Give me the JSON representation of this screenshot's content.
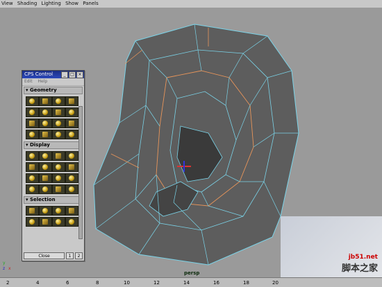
{
  "menu": [
    "View",
    "Shading",
    "Lighting",
    "Show",
    "Panels"
  ],
  "viewport": {
    "camera": "persp",
    "axis_labels": [
      "y",
      "z",
      "x"
    ]
  },
  "cps_control": {
    "title": "CPS Control",
    "menu": [
      "Edit",
      "Help"
    ],
    "sections": [
      {
        "label": "Geometry"
      },
      {
        "label": "Display"
      },
      {
        "label": "Selection"
      }
    ],
    "close_label": "Close",
    "small_buttons": [
      "1",
      "2"
    ]
  },
  "timeline": {
    "labels": [
      "2",
      "4",
      "6",
      "8",
      "10",
      "12",
      "14",
      "16",
      "18",
      "20"
    ]
  },
  "watermark": {
    "url": "jb51.net",
    "cn": "脚本之家"
  }
}
